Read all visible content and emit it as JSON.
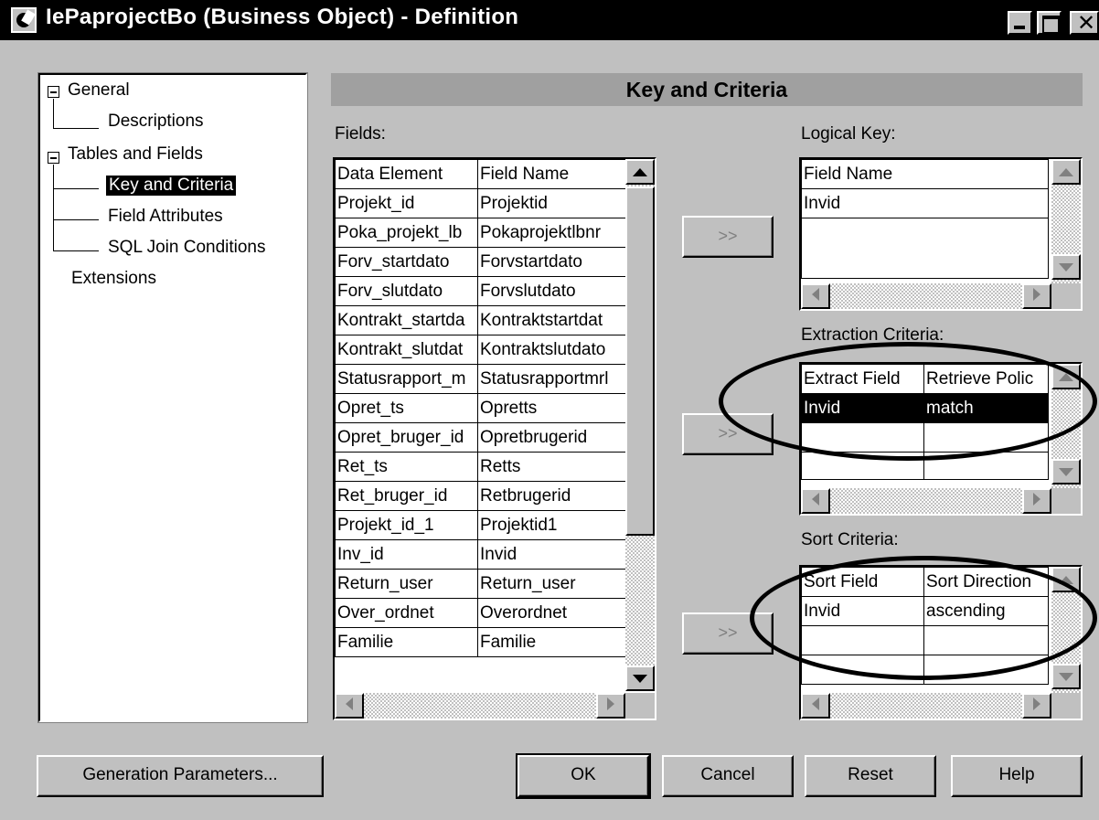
{
  "window": {
    "title": "IePaprojectBo (Business Object) - Definition",
    "close_glyph": "✕"
  },
  "tree": {
    "items": [
      {
        "label": "General"
      },
      {
        "label": "Descriptions"
      },
      {
        "label": "Tables and Fields"
      },
      {
        "label": "Key and Criteria"
      },
      {
        "label": "Field Attributes"
      },
      {
        "label": "SQL Join Conditions"
      },
      {
        "label": "Extensions"
      }
    ]
  },
  "panel": {
    "header": "Key and Criteria",
    "fields_label": "Fields:",
    "logical_key_label": "Logical Key:",
    "extraction_label": "Extraction Criteria:",
    "sort_label": "Sort Criteria:",
    "move_label": ">>"
  },
  "fields_table": {
    "columns": [
      "Data Element",
      "Field Name"
    ],
    "rows": [
      [
        "Projekt_id",
        "Projektid"
      ],
      [
        "Poka_projekt_lb",
        "Pokaprojektlbnr"
      ],
      [
        "Forv_startdato",
        "Forvstartdato"
      ],
      [
        "Forv_slutdato",
        "Forvslutdato"
      ],
      [
        "Kontrakt_startda",
        "Kontraktstartdat"
      ],
      [
        "Kontrakt_slutdat",
        "Kontraktslutdato"
      ],
      [
        "Statusrapport_m",
        "Statusrapportmrl"
      ],
      [
        "Opret_ts",
        "Opretts"
      ],
      [
        "Opret_bruger_id",
        "Opretbrugerid"
      ],
      [
        "Ret_ts",
        "Retts"
      ],
      [
        "Ret_bruger_id",
        "Retbrugerid"
      ],
      [
        "Projekt_id_1",
        "Projektid1"
      ],
      [
        "Inv_id",
        "Invid"
      ],
      [
        "Return_user",
        "Return_user"
      ],
      [
        "Over_ordnet",
        "Overordnet"
      ],
      [
        "Familie",
        "Familie"
      ]
    ]
  },
  "logical_key_table": {
    "columns": [
      "Field Name"
    ],
    "rows": [
      [
        "Invid"
      ]
    ]
  },
  "extraction_table": {
    "columns": [
      "Extract Field",
      "Retrieve Polic"
    ],
    "rows": [
      [
        "Invid",
        "match"
      ]
    ]
  },
  "sort_table": {
    "columns": [
      "Sort Field",
      "Sort Direction"
    ],
    "rows": [
      [
        "Invid",
        "ascending"
      ]
    ]
  },
  "buttons": {
    "generation": "Generation Parameters...",
    "ok": "OK",
    "cancel": "Cancel",
    "reset": "Reset",
    "help": "Help"
  },
  "colors": {
    "dialog_bg": "#c0c0c0",
    "titlebar_bg": "#000000",
    "header_bar": "#a0a0a0",
    "selection": "#000000"
  }
}
